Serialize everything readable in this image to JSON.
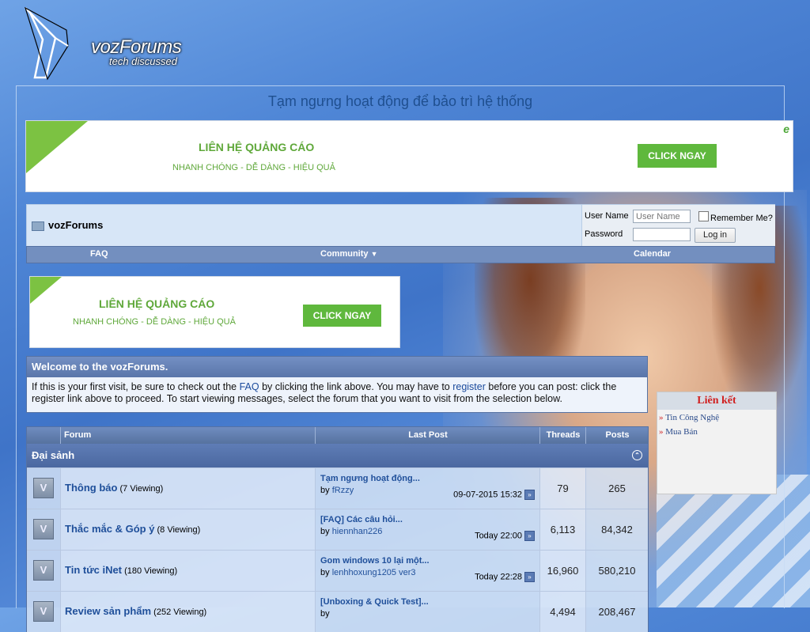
{
  "logo": {
    "title": "vozForums",
    "tagline": "tech discussed"
  },
  "notice": "Tạm ngưng hoạt động để bảo trì hệ thống",
  "ad": {
    "headline": "LIÊN HỆ QUẢNG CÁO",
    "subline": "NHANH CHÓNG - DỄ DÀNG - HIỆU QUẢ",
    "button": "CLICK NGAY",
    "badge": "e",
    "accent": "#7cc242"
  },
  "navbar": {
    "title": "vozForums"
  },
  "login": {
    "username_label": "User Name",
    "username_placeholder": "User Name",
    "remember_label": "Remember Me?",
    "password_label": "Password",
    "button": "Log in"
  },
  "menu": {
    "faq": "FAQ",
    "community": "Community",
    "community_arrow": "▼",
    "calendar": "Calendar"
  },
  "welcome": {
    "title": "Welcome to the vozForums.",
    "p1": "If this is your first visit, be sure to check out the ",
    "faq_link": "FAQ",
    "p2": " by clicking the link above. You may have to ",
    "register_link": "register",
    "p3": " before you can post: click the register link above to proceed. To start viewing messages, select the forum that you want to visit from the selection below."
  },
  "sidebar": {
    "title": "Liên kết",
    "bullet": "»",
    "items": [
      "Tin Công Nghệ",
      "Mua Bán"
    ]
  },
  "forum": {
    "columns": {
      "forum": "Forum",
      "last_post": "Last Post",
      "threads": "Threads",
      "posts": "Posts"
    },
    "category": "Đại sảnh",
    "collapse_icon": "⌃",
    "icon_letter": "V",
    "go_icon": "»",
    "rows": [
      {
        "name": "Thông báo",
        "viewing": "(7 Viewing)",
        "last_title": "Tạm ngưng hoạt động...",
        "by": "by",
        "user": "fRzzy",
        "date": "09-07-2015 15:32",
        "threads": "79",
        "posts": "265"
      },
      {
        "name": "Thắc mắc & Góp ý",
        "viewing": "(8 Viewing)",
        "last_title": "[FAQ] Các câu hỏi...",
        "by": "by",
        "user": "hiennhan226",
        "date": "Today 22:00",
        "threads": "6,113",
        "posts": "84,342"
      },
      {
        "name": "Tin tức iNet",
        "viewing": "(180 Viewing)",
        "last_title": "Gom windows 10 lại một...",
        "by": "by",
        "user": "lenhhoxung1205 ver3",
        "date": "Today 22:28",
        "threads": "16,960",
        "posts": "580,210"
      },
      {
        "name": "Review sản phẩm",
        "viewing": "(252 Viewing)",
        "last_title": "[Unboxing & Quick Test]...",
        "by": "by",
        "user": "",
        "date": "",
        "threads": "4,494",
        "posts": "208,467"
      }
    ]
  }
}
